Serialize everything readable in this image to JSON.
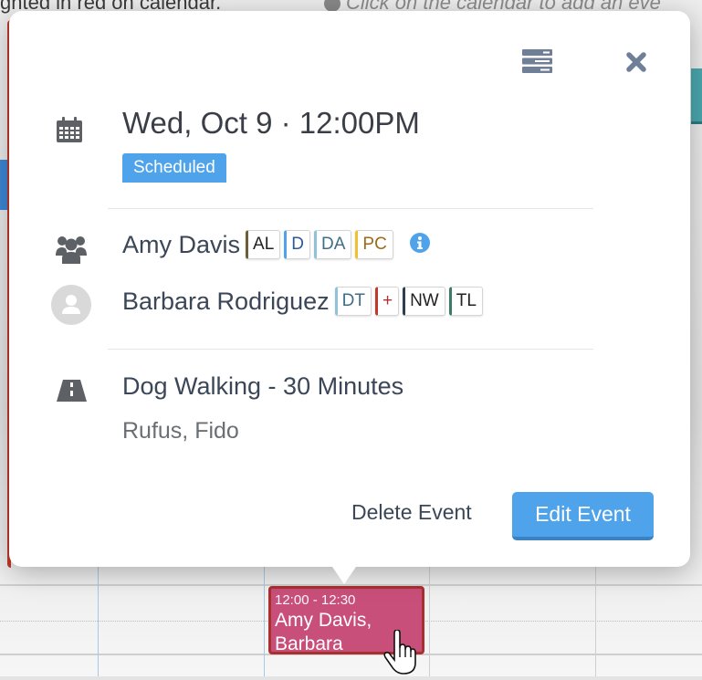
{
  "background": {
    "top_text": "ghted in red on calendar.",
    "hint_text": "Click on the calendar to add an eve",
    "event": {
      "time": "12:00 - 12:30",
      "title_line1": "Amy Davis,",
      "title_line2": "Barbara"
    }
  },
  "popover": {
    "header_icons": [
      "list-view-icon",
      "close-icon"
    ],
    "date_time": "Wed, Oct 9 · 12:00PM",
    "status": "Scheduled",
    "status_color": "#4ea3ea",
    "staff": [
      {
        "name": "Amy Davis",
        "icon": "users-icon",
        "tags": [
          {
            "label": "AL",
            "color": "#6b5e3a",
            "text_color": "#222"
          },
          {
            "label": "D",
            "color": "#4ea3ea",
            "text_color": "#2a5a9a"
          },
          {
            "label": "DA",
            "color": "#8fc3d8",
            "text_color": "#3f6f86"
          },
          {
            "label": "PC",
            "color": "#f0c030",
            "text_color": "#9c6a1a"
          }
        ],
        "has_info": true
      },
      {
        "name": "Barbara Rodriguez",
        "icon": "avatar-icon",
        "tags": [
          {
            "label": "DT",
            "color": "#8fc3d8",
            "text_color": "#3f6f86"
          },
          {
            "label": "+",
            "color": "#c0392b",
            "text_color": "#b03030"
          },
          {
            "label": "NW",
            "color": "#2c3e50",
            "text_color": "#222"
          },
          {
            "label": "TL",
            "color": "#3d7a68",
            "text_color": "#222"
          }
        ],
        "has_info": false
      }
    ],
    "service": {
      "icon": "road-icon",
      "name": "Dog Walking - 30 Minutes",
      "pets": "Rufus, Fido"
    },
    "actions": {
      "delete_label": "Delete Event",
      "edit_label": "Edit Event"
    }
  }
}
